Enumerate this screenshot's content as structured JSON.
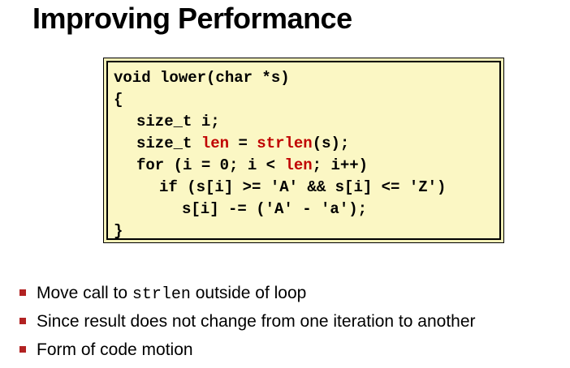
{
  "title": "Improving Performance",
  "code": {
    "line1": "void lower(char *s)",
    "line2": "{",
    "line3": "size_t i;",
    "line4_a": "size_t ",
    "line4_b": "len",
    "line4_c": " = ",
    "line4_d": "strlen",
    "line4_e": "(s);",
    "line5_a": "for (i = 0; i < ",
    "line5_b": "len",
    "line5_c": "; i++)",
    "line6": "if (s[i] >= 'A' && s[i] <= 'Z')",
    "line7": "s[i] -= ('A' - 'a');",
    "line8": "}"
  },
  "bullets": {
    "b1_pre": "Move call to ",
    "b1_code": "strlen",
    "b1_post": " outside of loop",
    "b2": "Since result does not change from one iteration to another",
    "b3": "Form of code motion"
  },
  "colors": {
    "code_background": "#fbf7c4",
    "highlight": "#c00000",
    "bullet_marker": "#b22222"
  }
}
